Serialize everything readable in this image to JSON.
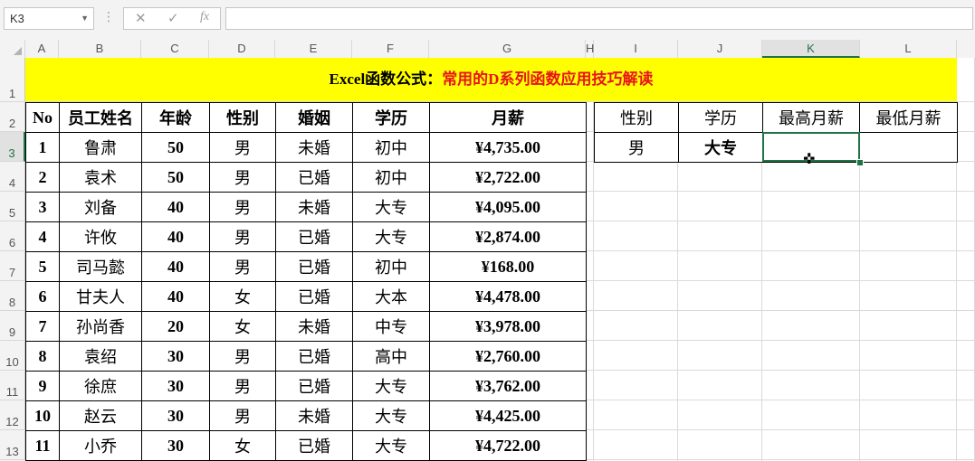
{
  "name_box": {
    "value": "K3"
  },
  "formula": {
    "cancel": "✕",
    "enter": "✓",
    "fx": "fx",
    "content": ""
  },
  "columns": [
    "A",
    "B",
    "C",
    "D",
    "E",
    "F",
    "G",
    "H",
    "I",
    "J",
    "K",
    "L"
  ],
  "rows": [
    "1",
    "2",
    "3",
    "4",
    "5",
    "6",
    "7",
    "8",
    "9",
    "10",
    "11",
    "12",
    "13"
  ],
  "active_cell": {
    "col": "K",
    "row": "3"
  },
  "title": {
    "prefix": "Excel函数公式：",
    "highlight": "常用的D系列函数应用技巧解读"
  },
  "main_table": {
    "headers": [
      "No",
      "员工姓名",
      "年龄",
      "性别",
      "婚姻",
      "学历",
      "月薪"
    ],
    "rows": [
      [
        "1",
        "鲁肃",
        "50",
        "男",
        "未婚",
        "初中",
        "¥4,735.00"
      ],
      [
        "2",
        "袁术",
        "50",
        "男",
        "已婚",
        "初中",
        "¥2,722.00"
      ],
      [
        "3",
        "刘备",
        "40",
        "男",
        "未婚",
        "大专",
        "¥4,095.00"
      ],
      [
        "4",
        "许攸",
        "40",
        "男",
        "已婚",
        "大专",
        "¥2,874.00"
      ],
      [
        "5",
        "司马懿",
        "40",
        "男",
        "已婚",
        "初中",
        "¥168.00"
      ],
      [
        "6",
        "甘夫人",
        "40",
        "女",
        "已婚",
        "大本",
        "¥4,478.00"
      ],
      [
        "7",
        "孙尚香",
        "20",
        "女",
        "未婚",
        "中专",
        "¥3,978.00"
      ],
      [
        "8",
        "袁绍",
        "30",
        "男",
        "已婚",
        "高中",
        "¥2,760.00"
      ],
      [
        "9",
        "徐庶",
        "30",
        "男",
        "已婚",
        "大专",
        "¥3,762.00"
      ],
      [
        "10",
        "赵云",
        "30",
        "男",
        "未婚",
        "大专",
        "¥4,425.00"
      ],
      [
        "11",
        "小乔",
        "30",
        "女",
        "已婚",
        "大专",
        "¥4,722.00"
      ]
    ]
  },
  "criteria_table": {
    "headers": [
      "性别",
      "学历",
      "最高月薪",
      "最低月薪"
    ],
    "row": [
      "男",
      "大专",
      "",
      ""
    ]
  }
}
